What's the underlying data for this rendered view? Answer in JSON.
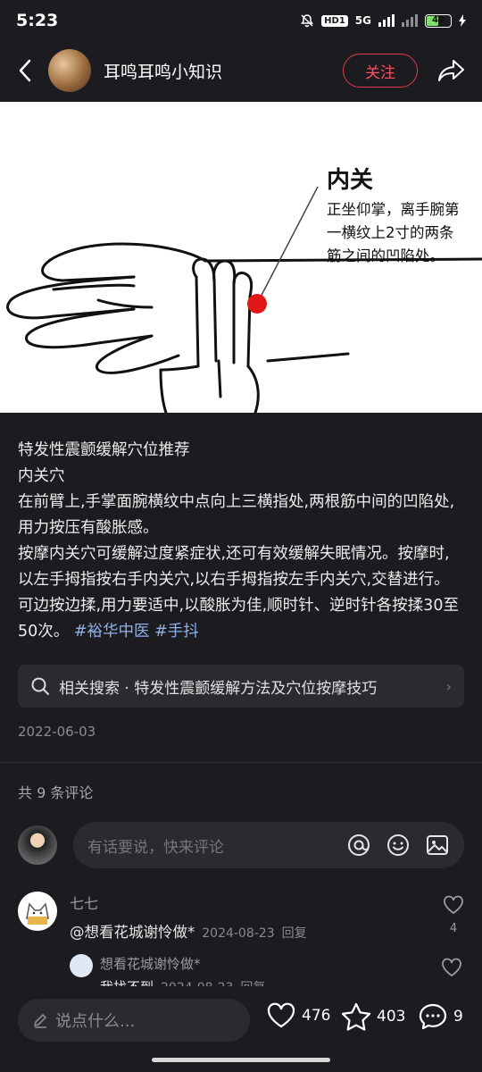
{
  "status": {
    "time": "5:23",
    "hd": "HD1",
    "net": "5G",
    "battery": "40"
  },
  "header": {
    "author": "耳鸣耳鸣小知识",
    "follow_label": "关注"
  },
  "hero": {
    "title": "内关",
    "desc_lines": [
      "正坐仰掌，离手腕第",
      "一横纹上2寸的两条",
      "筋之间的凹陷处。"
    ],
    "point_color": "#e01818"
  },
  "post": {
    "lines": [
      "特发性震颤缓解穴位推荐",
      "内关穴",
      "在前臂上,手掌面腕横纹中点向上三横指处,两根筋中间的凹陷处,用力按压有酸胀感。",
      "按摩内关穴可缓解过度紧症状,还可有效缓解失眠情况。按摩时,以左手拇指按右手内关穴,以右手拇指按左手内关穴,交替进行。可边按边揉,用力要适中,以酸胀为佳,顺时针、逆时针各按揉30至50次。"
    ],
    "tags": [
      "#裕华中医",
      "#手抖"
    ]
  },
  "related": {
    "text": "相关搜索 · 特发性震颤缓解方法及穴位按摩技巧"
  },
  "date": "2022-06-03",
  "comments": {
    "count_label": "共 9 条评论",
    "input_placeholder": "有话要说，快来评论",
    "items": [
      {
        "name": "七七",
        "text": "@想看花城谢怜做*",
        "time": "2024-08-23",
        "reply_label": "回复",
        "likes": "4"
      }
    ],
    "reply": {
      "name": "想看花城谢怜做*",
      "text": "我找不到",
      "time": "2024-08-23",
      "reply_label": "回复"
    }
  },
  "bottom": {
    "say_placeholder": "说点什么...",
    "likes": "476",
    "stars": "403",
    "comments": "9"
  },
  "colors": {
    "accent": "#ff4c5e",
    "tag": "#8fb1e6",
    "background": "#1c1c20"
  }
}
